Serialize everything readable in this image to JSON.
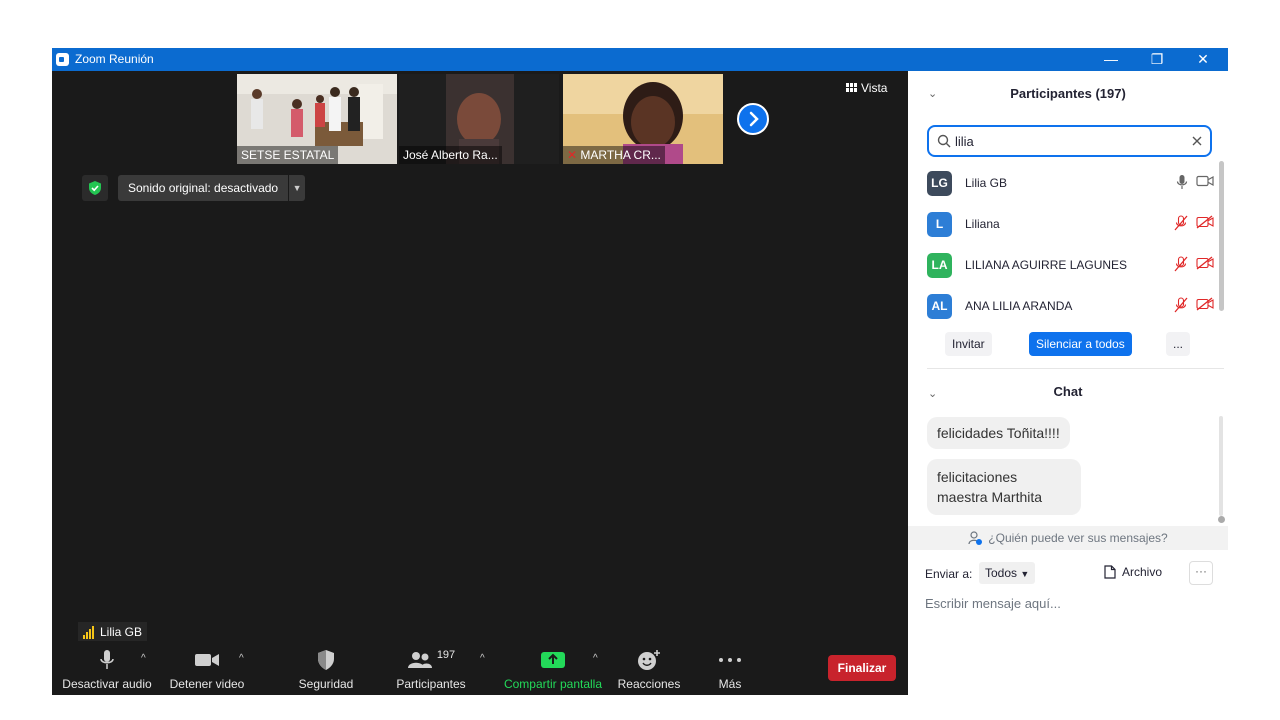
{
  "window": {
    "title": "Zoom Reunión",
    "controls": [
      "—",
      "❐",
      "✕"
    ]
  },
  "video": {
    "thumbnails": [
      {
        "label": "SETSE ESTATAL",
        "muted": false
      },
      {
        "label": "José Alberto Ra...",
        "muted": false
      },
      {
        "label": "MARTHA CR...",
        "muted": true
      }
    ],
    "vista_label": "Vista",
    "original_sound_label": "Sonido original: desactivado",
    "self_name": "Lilia GB"
  },
  "toolbar": {
    "audio_label": "Desactivar audio",
    "video_label": "Detener video",
    "security_label": "Seguridad",
    "participants_label": "Participantes",
    "participants_count": "197",
    "share_label": "Compartir pantalla",
    "reactions_label": "Reacciones",
    "more_label": "Más",
    "end_label": "Finalizar",
    "caret": "^"
  },
  "participants": {
    "title": "Participantes (197)",
    "search_value": "lilia",
    "list": [
      {
        "initials": "LG",
        "name": "Lilia GB",
        "color": "#3d4a5c",
        "muted": false
      },
      {
        "initials": "L",
        "name": "Liliana",
        "color": "#2d7ed6",
        "muted": true
      },
      {
        "initials": "LA",
        "name": "LILIANA AGUIRRE LAGUNES",
        "color": "#2fb35d",
        "muted": true
      },
      {
        "initials": "AL",
        "name": "ANA LILIA ARANDA",
        "color": "#2d7ed6",
        "muted": true
      }
    ],
    "invite_label": "Invitar",
    "mute_all_label": "Silenciar a todos",
    "more_label": "..."
  },
  "chat": {
    "title": "Chat",
    "messages": [
      {
        "text": "felicidades Toñita!!!!"
      },
      {
        "text": "felicitaciones maestra Marthita"
      }
    ],
    "who_can_see": "¿Quién puede ver sus mensajes?",
    "send_to_label": "Enviar a:",
    "recipient": "Todos",
    "file_label": "Archivo",
    "more_label": "···",
    "input_placeholder": "Escribir mensaje aquí..."
  },
  "colors": {
    "titlebar": "#0b6bd0",
    "accent": "#0e72ed",
    "end": "#c8232c",
    "share": "#23d959",
    "muted_red": "#e02828"
  }
}
